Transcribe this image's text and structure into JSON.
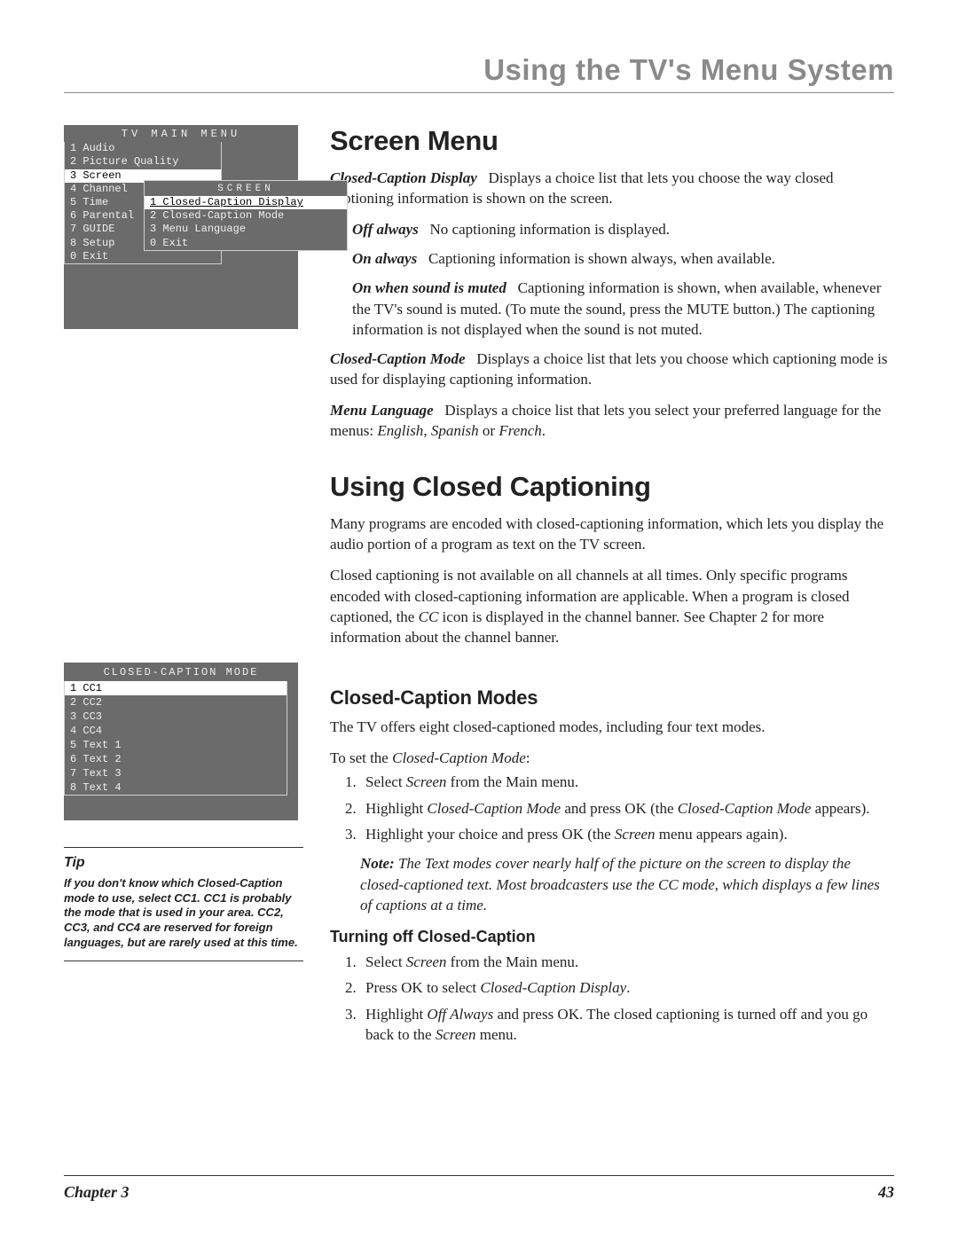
{
  "header": {
    "title": "Using the TV's Menu System"
  },
  "tv_menu": {
    "title": "TV MAIN MENU",
    "items": [
      {
        "num": "1",
        "label": "Audio"
      },
      {
        "num": "2",
        "label": "Picture Quality"
      },
      {
        "num": "3",
        "label": "Screen",
        "selected": true
      },
      {
        "num": "4",
        "label": "Channel"
      },
      {
        "num": "5",
        "label": "Time"
      },
      {
        "num": "6",
        "label": "Parental"
      },
      {
        "num": "7",
        "label": "GUIDE"
      },
      {
        "num": "8",
        "label": "Setup"
      },
      {
        "num": "0",
        "label": "Exit"
      }
    ],
    "submenu": {
      "title": "SCREEN",
      "items": [
        {
          "num": "1",
          "label": "Closed-Caption Display",
          "selected": true
        },
        {
          "num": "2",
          "label": "Closed-Caption Mode"
        },
        {
          "num": "3",
          "label": "Menu Language"
        },
        {
          "num": "0",
          "label": "Exit"
        }
      ]
    }
  },
  "cc_menu": {
    "title": "CLOSED-CAPTION MODE",
    "items": [
      {
        "num": "1",
        "label": "CC1",
        "selected": true
      },
      {
        "num": "2",
        "label": "CC2"
      },
      {
        "num": "3",
        "label": "CC3"
      },
      {
        "num": "4",
        "label": "CC4"
      },
      {
        "num": "5",
        "label": "Text 1"
      },
      {
        "num": "6",
        "label": "Text 2"
      },
      {
        "num": "7",
        "label": "Text 3"
      },
      {
        "num": "8",
        "label": "Text 4"
      }
    ]
  },
  "tip": {
    "title": "Tip",
    "text": "If you don't know which Closed-Caption mode to use, select CC1. CC1 is probably the mode that is used in your area. CC2, CC3, and CC4 are reserved for foreign languages, but are rarely used at this time."
  },
  "screen_menu": {
    "heading": "Screen Menu",
    "ccd_lead": "Closed-Caption Display",
    "ccd_rest": "Displays a choice list that lets you choose the way closed captioning information is shown on the screen.",
    "off_lead": "Off always",
    "off_rest": "No captioning information is displayed.",
    "on_lead": "On always",
    "on_rest": "Captioning information is shown always, when available.",
    "muted_lead": "On when sound is muted",
    "muted_rest": "Captioning information is shown, when available, whenever the TV's sound is muted. (To mute the sound, press the MUTE button.) The captioning information is not displayed when the sound is not muted.",
    "ccm_lead": "Closed-Caption Mode",
    "ccm_rest": "Displays a choice list that lets you choose which captioning mode is used for displaying captioning information.",
    "ml_lead": "Menu Language",
    "ml_pre": "Displays a choice list that lets you select your preferred language for the menus: ",
    "ml_en": "English",
    "ml_c1": ", ",
    "ml_sp": "Spanish",
    "ml_or": " or ",
    "ml_fr": "French",
    "ml_end": "."
  },
  "using_cc": {
    "heading": "Using Closed Captioning",
    "p1": "Many programs are encoded with closed-captioning information, which lets you display the audio portion of a program as text on the TV screen.",
    "p2a": "Closed captioning is not available on all channels at all times. Only specific programs encoded with closed-captioning information are applicable. When a program is closed captioned, the ",
    "p2_cc": "CC",
    "p2b": " icon is displayed in the channel banner. See Chapter 2 for more information about the channel banner."
  },
  "cc_modes": {
    "heading": "Closed-Caption Modes",
    "p1": "The TV offers eight closed-captioned modes, including four text modes.",
    "p2a": "To set the ",
    "p2_em": "Closed-Caption Mode",
    "p2b": ":",
    "step1a": "Select ",
    "step1_em": "Screen",
    "step1b": " from the Main menu.",
    "step2a": "Highlight ",
    "step2_em1": "Closed-Caption Mode",
    "step2b": " and press OK  (the ",
    "step2_em2": "Closed-Caption Mode",
    "step2c": " appears).",
    "step3a": "Highlight your choice and press OK (the ",
    "step3_em": "Screen",
    "step3b": " menu appears again).",
    "note_lead": "Note:",
    "note_rest": "The Text modes cover nearly half of the picture on the screen to display the closed-captioned text. Most broadcasters use the CC mode, which displays a few lines of captions at a time."
  },
  "turn_off": {
    "heading": "Turning off Closed-Caption",
    "s1a": "Select ",
    "s1_em": "Screen",
    "s1b": " from the Main menu.",
    "s2a": "Press OK to select ",
    "s2_em": "Closed-Caption Display",
    "s2b": ".",
    "s3a": "Highlight ",
    "s3_em1": "Off Always",
    "s3b": " and press OK. The closed captioning is turned off and you go back to the ",
    "s3_em2": "Screen",
    "s3c": " menu."
  },
  "footer": {
    "chapter": "Chapter 3",
    "page": "43"
  }
}
